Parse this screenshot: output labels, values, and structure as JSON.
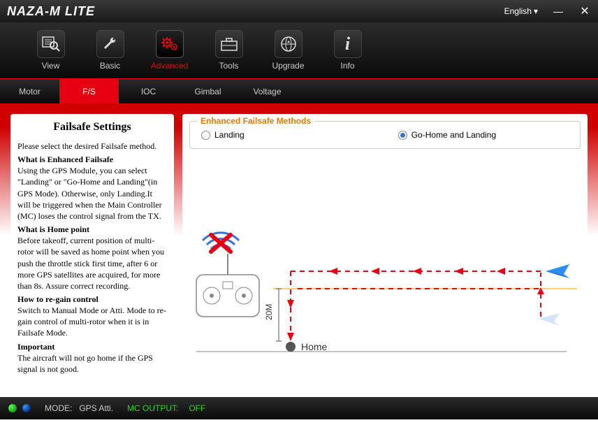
{
  "titlebar": {
    "title": "NAZA-M LITE",
    "language": "English"
  },
  "toolbar": {
    "view": "View",
    "basic": "Basic",
    "advanced": "Advanced",
    "tools": "Tools",
    "upgrade": "Upgrade",
    "info": "Info"
  },
  "subtabs": {
    "motor": "Motor",
    "fs": "F/S",
    "ioc": "IOC",
    "gimbal": "Gimbal",
    "voltage": "Voltage"
  },
  "settings": {
    "title": "Failsafe Settings",
    "intro": "Please select the desired Failsafe method.",
    "h1": "What is Enhanced Failsafe",
    "p1": "Using the GPS Module, you can select \"Landing\" or \"Go-Home and Landing\"(in GPS Mode). Otherwise, only Landing.It will be triggered when the Main Controller (MC) loses the control signal from the TX.",
    "h2": "What is Home point",
    "p2": "Before takeoff, current position of multi-rotor will be saved as home point when you push the throttle stick first time, after 6 or more GPS satellites are acquired, for more than 8s. Assure correct recording.",
    "h3": "How to re-gain control",
    "p3": "Switch to Manual Mode or Atti. Mode to re-gain control of multi-rotor when it is in Failsafe Mode.",
    "h4": "Important",
    "p4": "The aircraft will not go home if the GPS signal is not good."
  },
  "methods": {
    "legend": "Enhanced Failsafe Methods",
    "landing": "Landing",
    "gohome": "Go-Home and Landing",
    "selected": "gohome"
  },
  "diagram": {
    "distance_label": "20M",
    "home_label": "Home"
  },
  "status": {
    "mode_label": "MODE:",
    "mode_val": "GPS Atti.",
    "mcout_label": "MC OUTPUT:",
    "mcout_val": "OFF"
  }
}
